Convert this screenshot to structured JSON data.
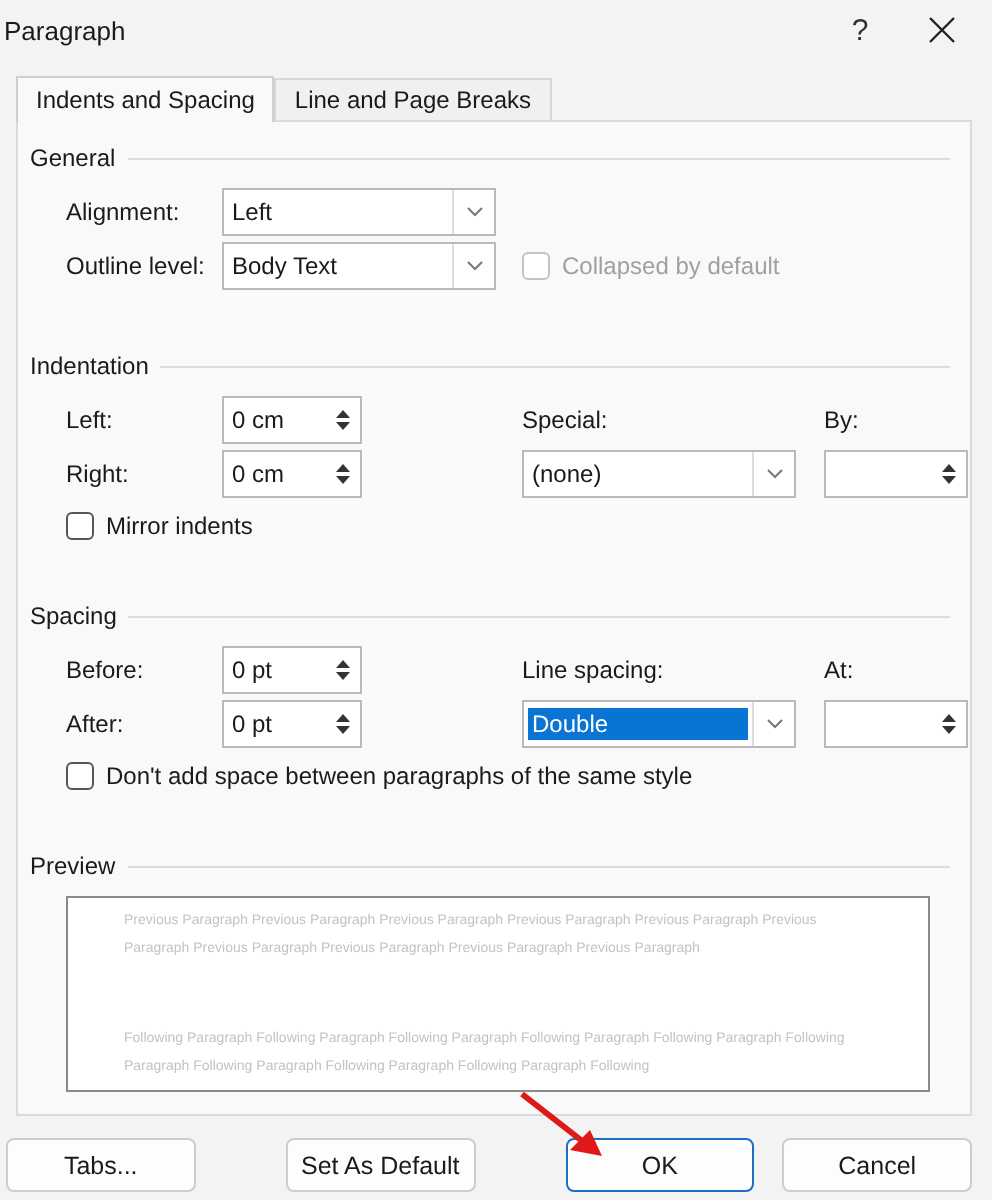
{
  "window": {
    "title": "Paragraph",
    "help": "?"
  },
  "tabs": [
    {
      "label": "Indents and Spacing",
      "selected": true
    },
    {
      "label": "Line and Page Breaks",
      "selected": false
    }
  ],
  "sections": [
    {
      "kind": "form",
      "title": "General",
      "fields": [
        {
          "label": "Alignment:",
          "kind": "dropdown",
          "value": "Left"
        },
        {
          "label": "Outline level:",
          "kind": "dropdown",
          "value": "Body Text"
        }
      ],
      "inline_checkbox": {
        "label": "Collapsed by default",
        "checked": false,
        "disabled": true
      }
    },
    {
      "kind": "form",
      "title": "Indentation",
      "fields": [
        {
          "label": "Left:",
          "kind": "spinner",
          "value": "0 cm"
        },
        {
          "label": "Right:",
          "kind": "spinner",
          "value": "0 cm"
        }
      ],
      "aside": [
        {
          "label": "Special:",
          "kind": "dropdown",
          "value": "(none)",
          "highlighted": false
        },
        {
          "label": "By:",
          "kind": "spinner"
        }
      ],
      "checkbox": {
        "label": "Mirror indents",
        "checked": false,
        "disabled": false
      }
    },
    {
      "kind": "form",
      "title": "Spacing",
      "fields": [
        {
          "label": "Before:",
          "kind": "spinner",
          "value": "0 pt"
        },
        {
          "label": "After:",
          "kind": "spinner",
          "value": "0 pt"
        }
      ],
      "aside": [
        {
          "label": "Line spacing:",
          "kind": "dropdown",
          "value": "Double",
          "highlighted": true
        },
        {
          "label": "At:",
          "kind": "spinner"
        }
      ],
      "checkbox": {
        "label": "Don't add space between paragraphs of the same style",
        "checked": false,
        "disabled": false
      }
    },
    {
      "kind": "preview",
      "title": "Preview",
      "previous_lines": [
        "Previous Paragraph Previous Paragraph Previous Paragraph Previous Paragraph Previous Paragraph Previous",
        "Paragraph Previous Paragraph Previous Paragraph Previous Paragraph Previous Paragraph"
      ],
      "following_lines": [
        "Following Paragraph Following Paragraph Following Paragraph Following Paragraph Following Paragraph Following",
        "Paragraph Following Paragraph Following Paragraph Following Paragraph Following"
      ]
    }
  ],
  "buttons": [
    {
      "label": "Tabs...",
      "default": false
    },
    {
      "label": "Set As Default",
      "default": false
    },
    {
      "label": "OK",
      "default": true
    },
    {
      "label": "Cancel",
      "default": false
    }
  ]
}
